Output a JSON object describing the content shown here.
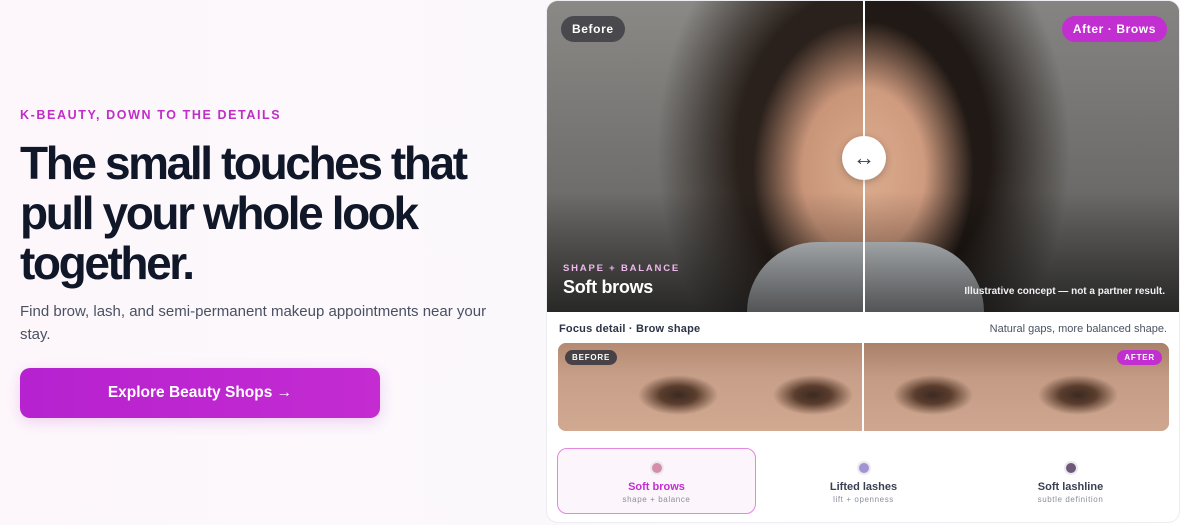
{
  "hero_left": {
    "eyebrow": "K-BEAUTY, DOWN TO THE DETAILS",
    "headline": "The small touches that pull your whole look together.",
    "subtext": "Find brow, lash, and semi-permanent makeup appointments near your stay.",
    "cta_label": "Explore Beauty Shops →"
  },
  "comparison": {
    "before_label": "Before",
    "after_label": "After · Brows",
    "handle_icon": "↔",
    "tag_eyebrow": "SHAPE + BALANCE",
    "tag_title": "Soft brows",
    "disclaimer": "Illustrative concept — not a partner result.",
    "focus_label": "Focus detail · Brow shape",
    "focus_note": "Natural gaps, more balanced shape.",
    "mini_before": "BEFORE",
    "mini_after": "AFTER"
  },
  "options": [
    {
      "label": "Soft brows",
      "sub": "shape + balance",
      "dot_color": "#d38ea8",
      "active": true
    },
    {
      "label": "Lifted lashes",
      "sub": "lift + openness",
      "dot_color": "#a294d0",
      "active": false
    },
    {
      "label": "Soft lashline",
      "sub": "subtle definition",
      "dot_color": "#6e5a78",
      "active": false
    }
  ],
  "colors": {
    "accent": "#c12fd0",
    "heading": "#0f1729"
  }
}
